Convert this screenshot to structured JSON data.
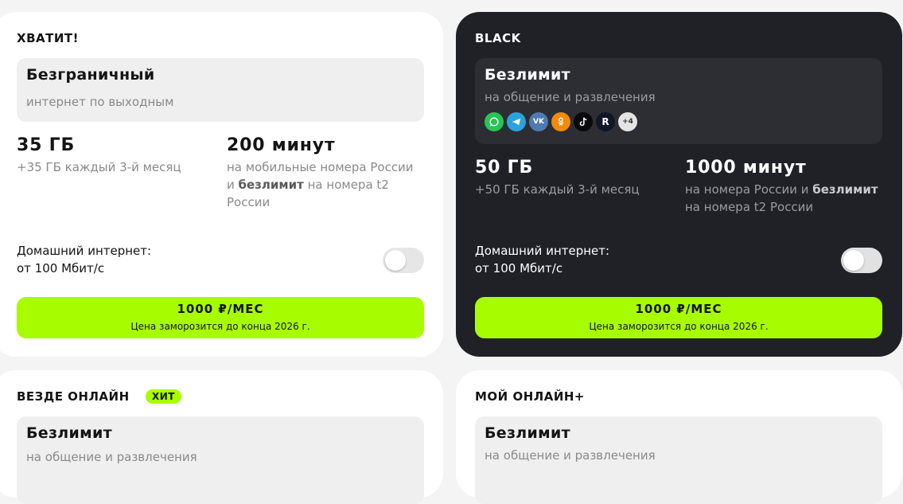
{
  "cards": [
    {
      "title": "Хватит!",
      "box_title": "Безграничный",
      "box_sub": "интернет по выходным",
      "gb": "35 ГБ",
      "gb_note": "+35 ГБ каждый 3-й месяц",
      "minutes": "200 минут",
      "minutes_note_1": "на мобильные номера России",
      "minutes_note_2a": "и ",
      "minutes_note_2b": "безлимит",
      "minutes_note_2c": " на номера t2",
      "minutes_note_3": "России",
      "home_1": "Домашний интернет:",
      "home_2": "от 100 Мбит/с",
      "price": "1000 ₽/МЕС",
      "price_note": "Цена заморозится до конца 2026 г."
    },
    {
      "title": "Black",
      "box_title": "Безлимит",
      "box_sub": "на общение и развлечения",
      "icons": [
        "whatsapp-icon",
        "telegram-icon",
        "vk-icon",
        "ok-icon",
        "tiktok-icon",
        "rutube-icon"
      ],
      "icons_more": "+4",
      "gb": "50 ГБ",
      "gb_note": "+50 ГБ каждый 3-й месяц",
      "minutes": "1000 минут",
      "minutes_note_1a": "на номера России и ",
      "minutes_note_1b": "безлимит",
      "minutes_note_2": "на номера t2 России",
      "home_1": "Домашний интернет:",
      "home_2": "от 100 Мбит/с",
      "price": "1000 ₽/МЕС",
      "price_note": "Цена заморозится до конца 2026 г."
    },
    {
      "title": "Везде онлайн",
      "badge": "ХИТ",
      "box_title": "Безлимит",
      "box_sub": "на общение и развлечения"
    },
    {
      "title": "Мой онлайн+",
      "box_title": "Безлимит",
      "box_sub": "на общение и развлечения"
    }
  ],
  "colors": {
    "accent": "#a8fc00",
    "dark_card": "#1f2127",
    "page_bg": "#f4f4f4"
  }
}
